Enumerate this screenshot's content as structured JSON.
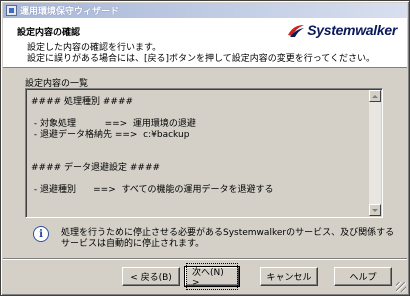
{
  "window": {
    "title": "運用環境保守ウィザード"
  },
  "header": {
    "title": "設定内容の確認",
    "desc_line1": "設定した内容の確認を行います。",
    "desc_line2": "設定に誤りがある場合には、[戻る]ボタンを押して設定内容の変更を行ってください。",
    "logo_text": "Systemwalker"
  },
  "summary": {
    "label": "設定内容の一覧",
    "lines": [
      "#### 処理種別 ####",
      "",
      " - 対象処理          ==>  運用環境の退避",
      " - 退避データ格納先 ==>  c:¥backup",
      "",
      "",
      "#### データ退避設定 ####",
      "",
      " - 退避種別      ==>  すべての機能の運用データを退避する"
    ]
  },
  "info": {
    "line1": "処理を行うために停止させる必要があるSystemwalkerのサービス、及び関係する",
    "line2": "サービスは自動的に停止されます。"
  },
  "buttons": {
    "back": "< 戻る(B)",
    "next": "次へ(N) >",
    "cancel": "キャンセル",
    "help": "ヘルプ"
  },
  "icons": {
    "title": "app-window-icon",
    "logo": "systemwalker-logo-icon",
    "info": "info-icon"
  },
  "colors": {
    "titlebar_start": "#a6b6d8",
    "titlebar_end": "#d8dfef",
    "dialog_bg": "#d4d0c8",
    "logo_text": "#0a1a5a",
    "logo_red": "#d02020",
    "info_blue": "#2040a0"
  }
}
